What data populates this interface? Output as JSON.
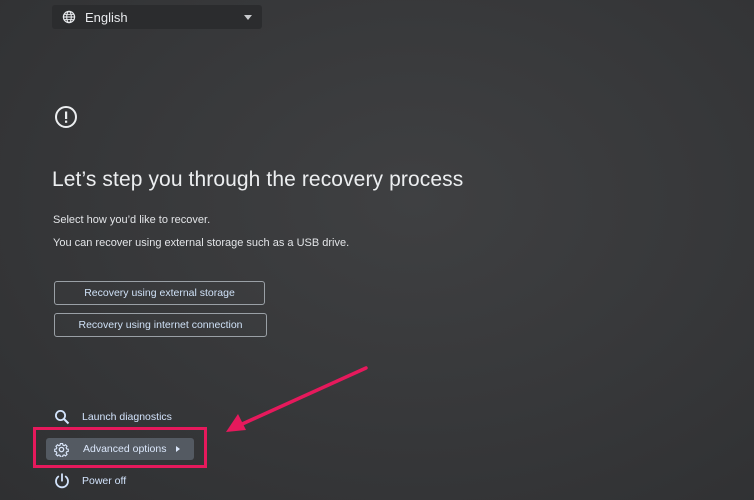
{
  "language_selector": {
    "value": "English",
    "globe_icon": "globe-icon",
    "dropdown_icon": "caret-down-icon"
  },
  "header": {
    "alert_icon": "exclamation-circle-icon",
    "title": "Let’s step you through the recovery process"
  },
  "description": {
    "line1": "Select how you’d like to recover.",
    "line2": "You can recover using external storage such as a USB drive."
  },
  "options": [
    {
      "label": "Recovery using external storage"
    },
    {
      "label": "Recovery using internet connection"
    }
  ],
  "footer_menu": {
    "diagnostics": {
      "label": "Launch diagnostics",
      "icon": "search-icon"
    },
    "advanced": {
      "label": "Advanced options",
      "icon": "gear-icon"
    },
    "power": {
      "label": "Power off",
      "icon": "power-icon"
    }
  },
  "annotation": {
    "highlight_color": "#e6195c"
  }
}
